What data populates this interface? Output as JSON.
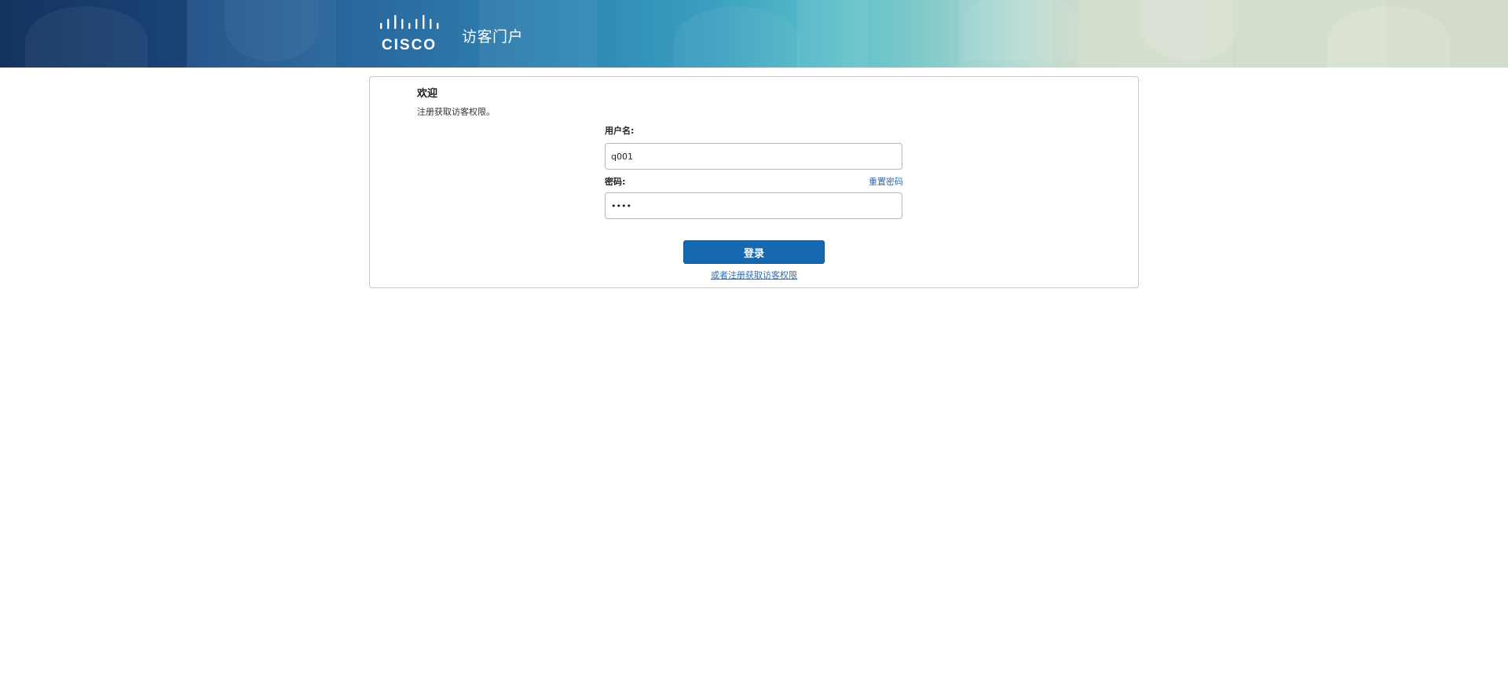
{
  "header": {
    "logo_text": "CISCO",
    "portal_title": "访客门户"
  },
  "welcome": {
    "title": "欢迎",
    "subtitle": "注册获取访客权限。"
  },
  "form": {
    "username_label": "用户名:",
    "username_value": "q001",
    "password_label": "密码:",
    "password_value": "1234",
    "reset_password_link": "重置密码",
    "login_button": "登录",
    "register_link": "或者注册获取访客权限"
  },
  "colors": {
    "button": "#1668b0",
    "link": "#2a6db0",
    "banner_left": "#173a68",
    "banner_right": "#d4dccb"
  }
}
